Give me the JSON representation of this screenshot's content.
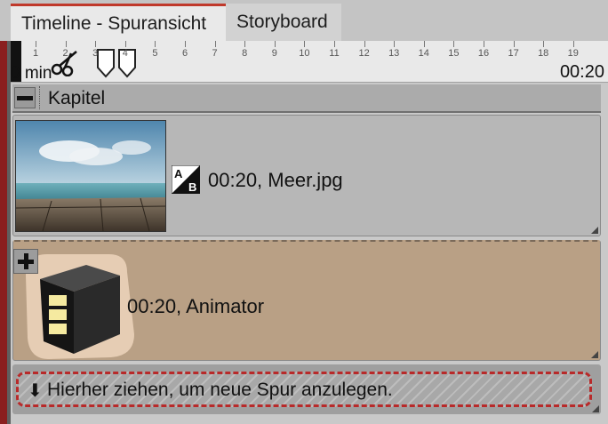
{
  "tabs": [
    {
      "label": "Timeline - Spuransicht",
      "active": true
    },
    {
      "label": "Storyboard",
      "active": false
    }
  ],
  "ruler": {
    "start_label": "0 min",
    "end_label": "00:20",
    "tick_labels": [
      "1",
      "2",
      "3",
      "4",
      "5",
      "6",
      "7",
      "8",
      "9",
      "10",
      "11",
      "12",
      "13",
      "14",
      "15",
      "16",
      "17",
      "18",
      "19"
    ]
  },
  "chapter": {
    "label": "Kapitel"
  },
  "tracks": [
    {
      "label": "00:20, Meer.jpg",
      "icon": "ab-transition-icon"
    },
    {
      "label": "00:20, Animator",
      "icon": "animator-box-icon"
    }
  ],
  "drop_zone": {
    "arrow": "⬇",
    "text": "Hierher ziehen, um neue Spur anzulegen."
  },
  "colors": {
    "accent": "#c0392b",
    "animator_track": "#b9a085",
    "image_track": "#b7b7b7"
  }
}
